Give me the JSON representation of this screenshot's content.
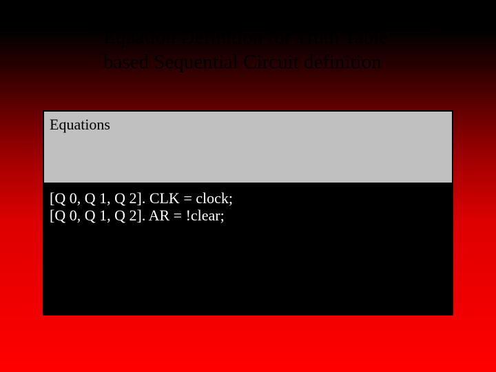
{
  "slide": {
    "title_line1": "Equation Definition for Truth Table",
    "title_line2": "based Sequential Circuit definition"
  },
  "box": {
    "header": "Equations",
    "eq1": "[Q 0, Q 1, Q 2]. CLK = clock;",
    "eq2": "[Q 0, Q 1, Q 2]. AR = !clear;"
  }
}
